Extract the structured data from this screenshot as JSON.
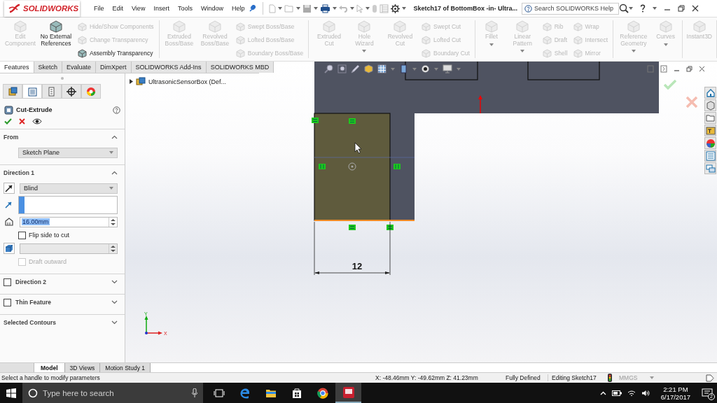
{
  "title_bar": {
    "logo": "SOLIDWORKS",
    "menu": [
      "File",
      "Edit",
      "View",
      "Insert",
      "Tools",
      "Window",
      "Help"
    ],
    "document_title": "Sketch17 of BottomBox -in- Ultra...",
    "search": {
      "placeholder": "Search SOLIDWORKS Help"
    }
  },
  "ribbon": {
    "groups": [
      {
        "tools": [
          {
            "kind": "large",
            "label": "Edit Component",
            "disabled": true,
            "dropdown": false
          },
          {
            "kind": "large",
            "label": "No External References",
            "disabled": false,
            "dropdown": false
          },
          {
            "kind": "small",
            "label": "Hide/Show Components",
            "disabled": true
          },
          {
            "kind": "small",
            "label": "Change Transparency",
            "disabled": true
          },
          {
            "kind": "small",
            "label": "Assembly Transparency",
            "disabled": false
          }
        ]
      },
      {
        "tools": [
          {
            "kind": "large",
            "label": "Extruded Boss/Base",
            "disabled": true,
            "dropdown": false
          },
          {
            "kind": "large",
            "label": "Revolved Boss/Base",
            "disabled": true,
            "dropdown": false
          },
          {
            "kind": "small",
            "label": "Swept Boss/Base",
            "disabled": true
          },
          {
            "kind": "small",
            "label": "Lofted Boss/Base",
            "disabled": true
          },
          {
            "kind": "small",
            "label": "Boundary Boss/Base",
            "disabled": true
          }
        ]
      },
      {
        "tools": [
          {
            "kind": "large",
            "label": "Extruded Cut",
            "disabled": true,
            "dropdown": false
          },
          {
            "kind": "large",
            "label": "Hole Wizard",
            "disabled": true,
            "dropdown": true
          },
          {
            "kind": "large",
            "label": "Revolved Cut",
            "disabled": true,
            "dropdown": false
          },
          {
            "kind": "small",
            "label": "Swept Cut",
            "disabled": true
          },
          {
            "kind": "small",
            "label": "Lofted Cut",
            "disabled": true
          },
          {
            "kind": "small",
            "label": "Boundary Cut",
            "disabled": true
          }
        ]
      },
      {
        "tools": [
          {
            "kind": "large",
            "label": "Fillet",
            "disabled": true,
            "dropdown": true
          },
          {
            "kind": "large",
            "label": "Linear Pattern",
            "disabled": true,
            "dropdown": true
          },
          {
            "kind": "small",
            "label": "Rib",
            "disabled": true
          },
          {
            "kind": "small",
            "label": "Draft",
            "disabled": true
          },
          {
            "kind": "small",
            "label": "Shell",
            "disabled": true
          },
          {
            "kind": "small",
            "label": "Wrap",
            "disabled": true
          },
          {
            "kind": "small",
            "label": "Intersect",
            "disabled": true
          },
          {
            "kind": "small",
            "label": "Mirror",
            "disabled": true
          }
        ]
      },
      {
        "tools": [
          {
            "kind": "large",
            "label": "Reference Geometry",
            "disabled": true,
            "dropdown": true
          },
          {
            "kind": "large",
            "label": "Curves",
            "disabled": true,
            "dropdown": true
          }
        ]
      },
      {
        "tools": [
          {
            "kind": "large",
            "label": "Instant3D",
            "disabled": true,
            "dropdown": false
          }
        ]
      }
    ]
  },
  "tabs": [
    {
      "label": "Features",
      "selected": true
    },
    {
      "label": "Sketch",
      "selected": false
    },
    {
      "label": "Evaluate",
      "selected": false
    },
    {
      "label": "DimXpert",
      "selected": false
    },
    {
      "label": "SOLIDWORKS Add-Ins",
      "selected": false
    },
    {
      "label": "SOLIDWORKS MBD",
      "selected": false
    }
  ],
  "feature_tree": {
    "root": {
      "label": "UltrasonicSensorBox  (Def...",
      "expanded": false
    }
  },
  "property_manager": {
    "tabs": [
      {
        "kind": "feature",
        "selected": false
      },
      {
        "kind": "property",
        "selected": true
      },
      {
        "kind": "configuration",
        "selected": false
      },
      {
        "kind": "dimxpert",
        "selected": false
      },
      {
        "kind": "display",
        "selected": false
      }
    ],
    "title": "Cut-Extrude",
    "sections": [
      {
        "title": "From",
        "expanded": true,
        "rows": [
          {
            "kind": "select",
            "value": "Sketch Plane",
            "disabled": false
          }
        ]
      },
      {
        "title": "Direction 1",
        "expanded": true,
        "rows": [
          {
            "kind": "direction-select",
            "value": "Blind",
            "disabled": false
          },
          {
            "kind": "selection-list"
          },
          {
            "kind": "depth-spinner",
            "value": "16.00mm",
            "highlighted": true,
            "disabled": false
          },
          {
            "kind": "checkbox",
            "label": "Flip side to cut",
            "checked": false,
            "disabled": false
          },
          {
            "kind": "draft-spinner",
            "disabled": true
          },
          {
            "kind": "checkbox",
            "label": "Draft outward",
            "checked": false,
            "disabled": true
          }
        ]
      },
      {
        "title": "Direction 2",
        "expanded": false,
        "checkbox": {
          "checked": false
        }
      },
      {
        "title": "Thin Feature",
        "expanded": false,
        "checkbox": {
          "checked": false
        }
      },
      {
        "title": "Selected Contours",
        "expanded": false
      }
    ]
  },
  "canvas": {
    "dimension": "12",
    "triad": {
      "y_label": "Y",
      "x_label": "X"
    }
  },
  "bottom_tabs": [
    {
      "label": "Model",
      "selected": true
    },
    {
      "label": "3D Views",
      "selected": false
    },
    {
      "label": "Motion Study 1",
      "selected": false
    }
  ],
  "status_bar": {
    "message": "Select a handle to modify parameters",
    "coordinates": "X: -48.46mm Y: -49.62mm Z: 41.23mm",
    "sketch_status": "Fully Defined",
    "mode": "Editing Sketch17",
    "units": "MMGS"
  },
  "taskbar": {
    "search": {
      "placeholder": "Type here to search"
    },
    "time": "2:21 PM",
    "date": "6/17/2017",
    "notification_count": "2"
  }
}
